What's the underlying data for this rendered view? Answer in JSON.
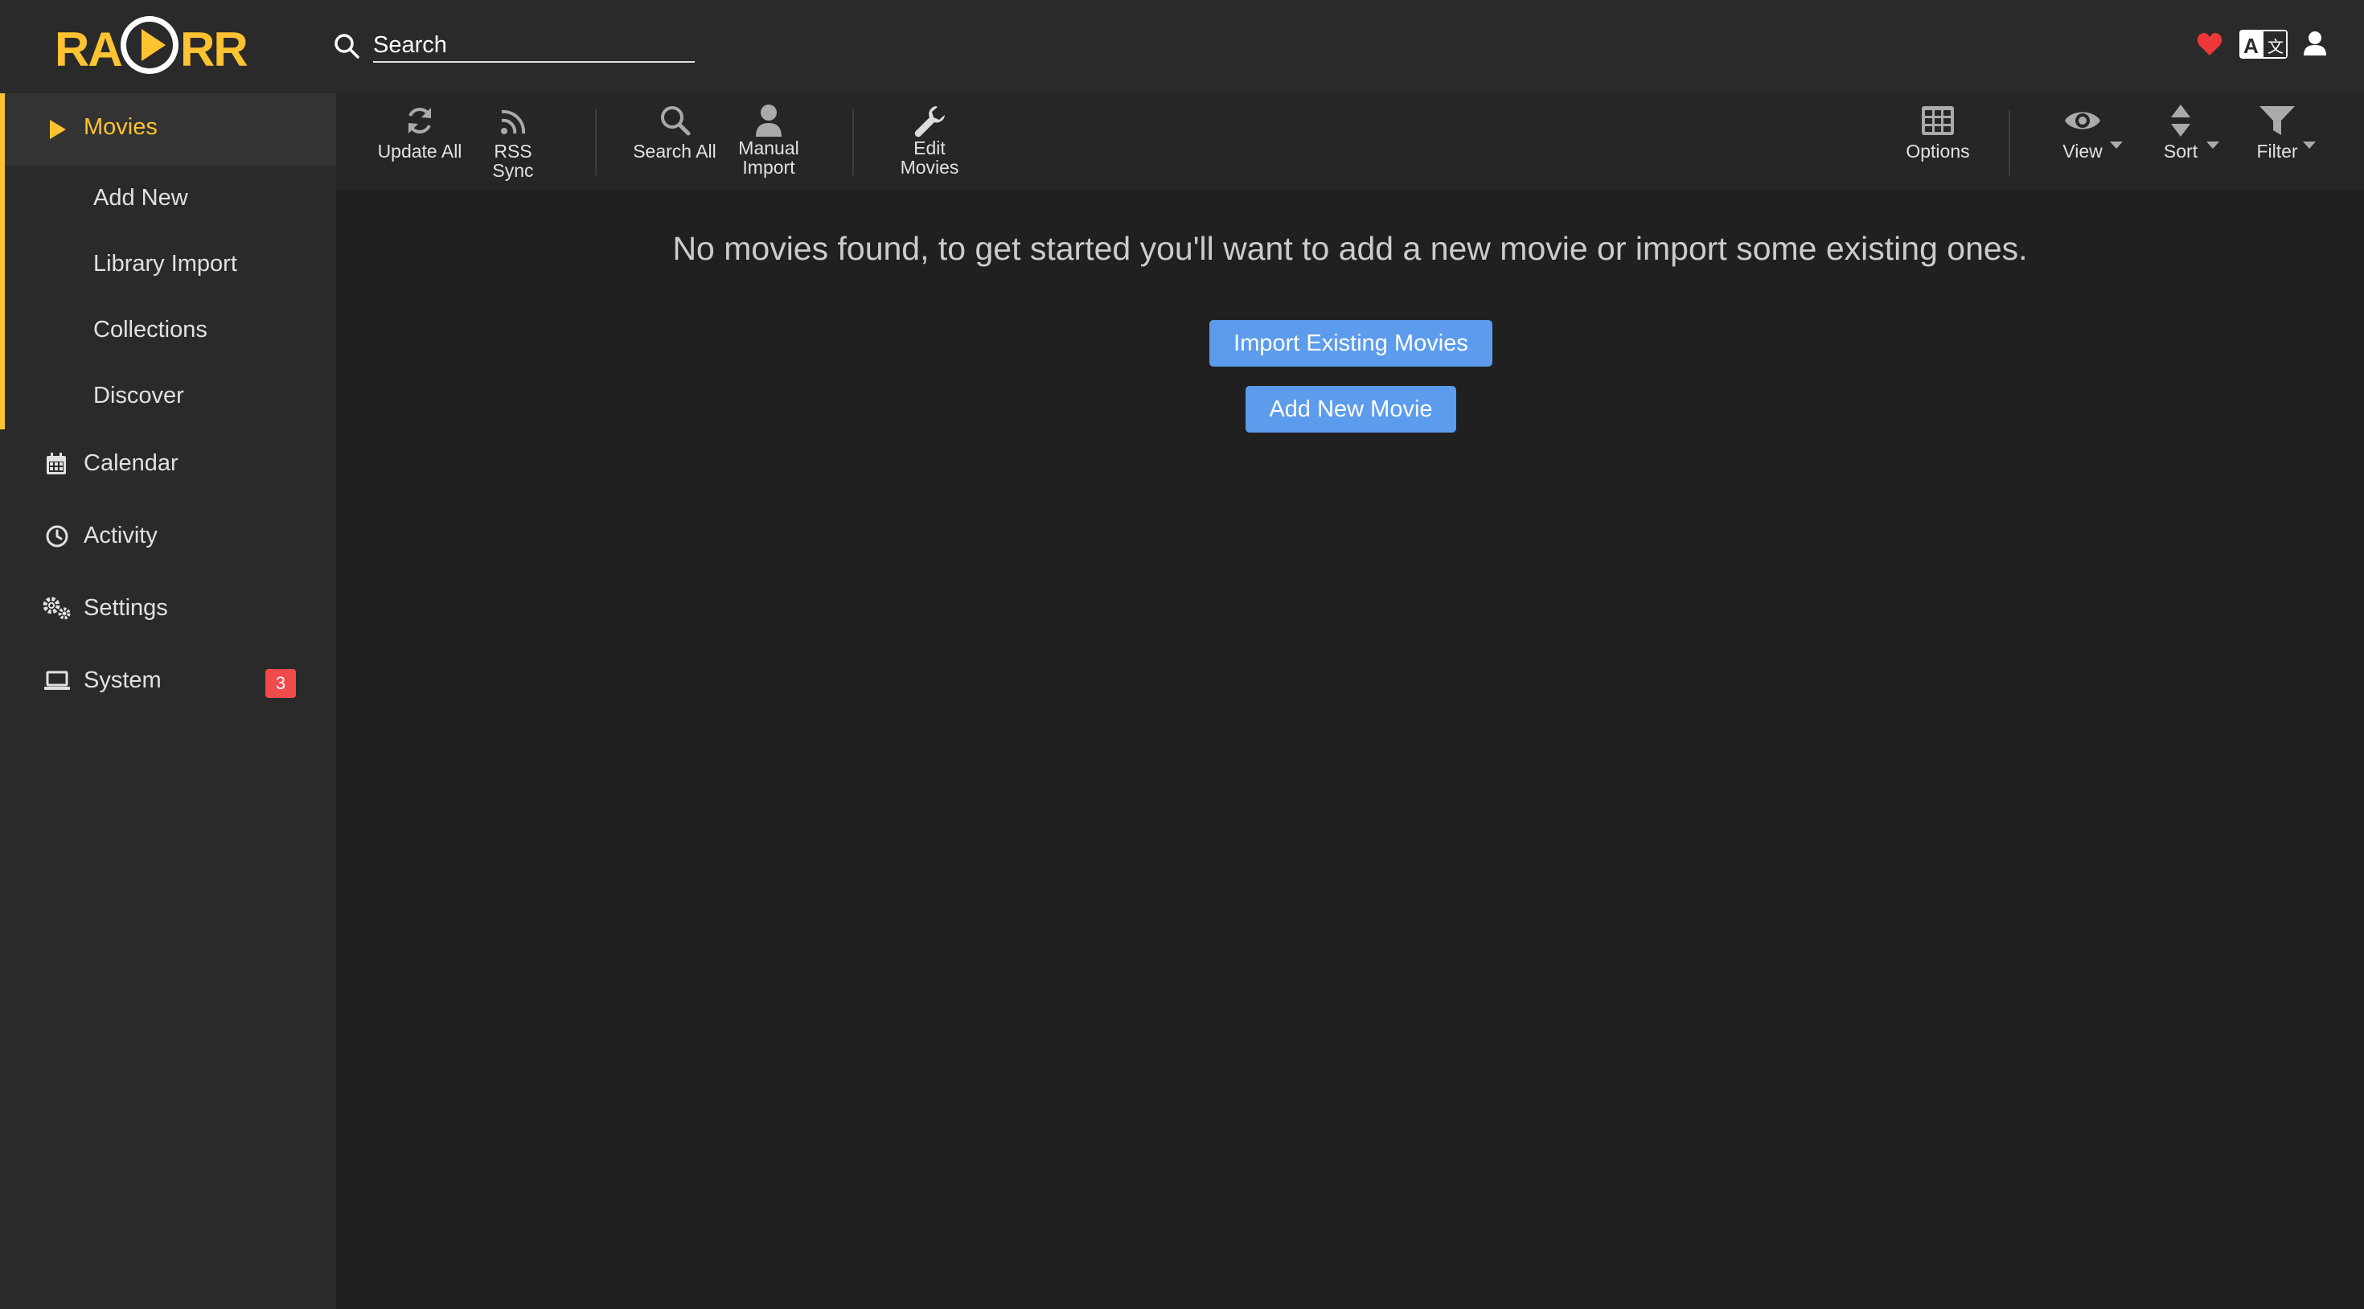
{
  "app": {
    "name": "Radarr",
    "logo_text": "RADARR"
  },
  "header": {
    "search": {
      "placeholder": "Search",
      "value": ""
    },
    "icons": [
      "heart-icon",
      "translate-icon",
      "user-icon"
    ]
  },
  "sidebar": {
    "movies": {
      "label": "Movies",
      "sub_items": [
        {
          "label": "Add New"
        },
        {
          "label": "Library Import"
        },
        {
          "label": "Collections"
        },
        {
          "label": "Discover"
        }
      ]
    },
    "items": [
      {
        "label": "Calendar",
        "icon": "calendar-icon"
      },
      {
        "label": "Activity",
        "icon": "clock-icon"
      },
      {
        "label": "Settings",
        "icon": "gears-icon"
      },
      {
        "label": "System",
        "icon": "laptop-icon",
        "badge": "3"
      }
    ]
  },
  "toolbar": {
    "update_all": "Update All",
    "rss_sync": "RSS Sync",
    "search_all": "Search All",
    "manual_import_1": "Manual",
    "manual_import_2": "Import",
    "edit_movies_1": "Edit",
    "edit_movies_2": "Movies",
    "options": "Options",
    "view": "View",
    "sort": "Sort",
    "filter": "Filter"
  },
  "main": {
    "empty_message": "No movies found, to get started you'll want to add a new movie or import some existing ones.",
    "import_button": "Import Existing Movies",
    "add_button": "Add New Movie"
  },
  "colors": {
    "accent": "#ffc230",
    "button": "#5d9cec",
    "badge": "#f04b4b",
    "heart": "#ee3838"
  }
}
